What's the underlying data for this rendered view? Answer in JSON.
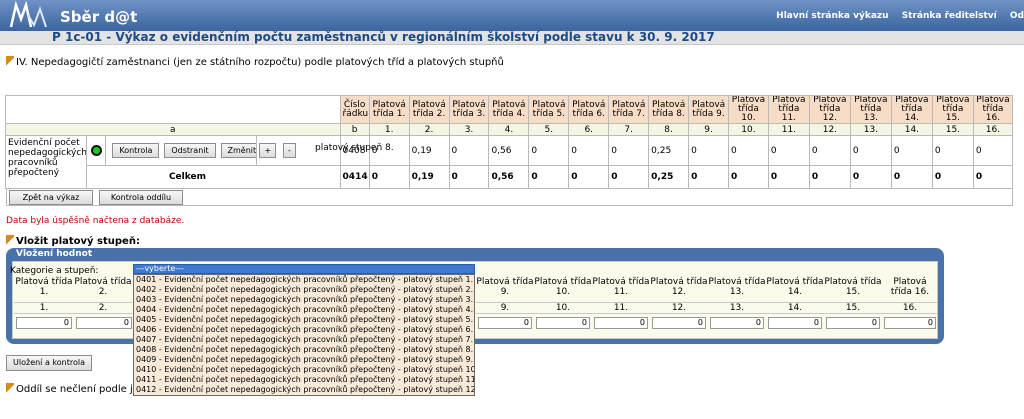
{
  "header": {
    "app_title": "Sběr d@t",
    "links": [
      "Hlavní stránka výkazu",
      "Stránka ředitelství",
      "Od"
    ],
    "report_title": "P 1c-01 - Výkaz o evidenčním počtu zaměstnanců v regionálním školství podle stavu k 30. 9. 2017"
  },
  "section_title": "IV. Nepedagogičtí zaměstnanci (jen ze státního rozpočtu) podle platových tříd a platových stupňů",
  "table": {
    "col_a": "a",
    "col_b_header": "Číslo řádku",
    "col_b": "b",
    "tridy": [
      "Platová třída 1.",
      "Platová třída 2.",
      "Platová třída 3.",
      "Platová třída 4.",
      "Platová třída 5.",
      "Platová třída 6.",
      "Platová třída 7.",
      "Platová třída 8.",
      "Platová třída 9.",
      "Platová třída 10.",
      "Platová třída 11.",
      "Platová třída 12.",
      "Platová třída 13.",
      "Platová třída 14.",
      "Platová třída 15.",
      "Platová třída 16."
    ],
    "nums": [
      "1.",
      "2.",
      "3.",
      "4.",
      "5.",
      "6.",
      "7.",
      "8.",
      "9.",
      "10.",
      "11.",
      "12.",
      "13.",
      "14.",
      "15.",
      "16."
    ],
    "row_label": "Evidenční počet nepedagogických pracovníků přepočtený",
    "buttons": {
      "kontrola": "Kontrola",
      "odstranit": "Odstranit",
      "zmenit": "Změnit",
      "plus": "+",
      "minus": "-"
    },
    "row1": {
      "label": "platový stupeň 8.",
      "code": "0408",
      "values": [
        "0",
        "0,19",
        "0",
        "0,56",
        "0",
        "0",
        "0",
        "0,25",
        "0",
        "0",
        "0",
        "0",
        "0",
        "0",
        "0",
        "0"
      ]
    },
    "row2": {
      "label": "Celkem",
      "code": "0414",
      "values": [
        "0",
        "0,19",
        "0",
        "0,56",
        "0",
        "0",
        "0",
        "0,25",
        "0",
        "0",
        "0",
        "0",
        "0",
        "0",
        "0",
        "0"
      ]
    }
  },
  "actions": {
    "back": "Zpět na výkaz",
    "check_section": "Kontrola oddílu"
  },
  "success_msg": "Data byla úspěšně načtena z databáze.",
  "insert_title": "Vložit platový stupeň:",
  "panel": {
    "title": "Vložení hodnot",
    "category_label": "Kategorie a stupeň:",
    "select_value": "---vyberte---",
    "options": [
      "0401 - Evidenční počet nepedagogických pracovníků přepočtený - platový stupeň 1.",
      "0402 - Evidenční počet nepedagogických pracovníků přepočtený - platový stupeň 2.",
      "0403 - Evidenční počet nepedagogických pracovníků přepočtený - platový stupeň 3.",
      "0404 - Evidenční počet nepedagogických pracovníků přepočtený - platový stupeň 4.",
      "0405 - Evidenční počet nepedagogických pracovníků přepočtený - platový stupeň 5.",
      "0406 - Evidenční počet nepedagogických pracovníků přepočtený - platový stupeň 6.",
      "0407 - Evidenční počet nepedagogických pracovníků přepočtený - platový stupeň 7.",
      "0408 - Evidenční počet nepedagogických pracovníků přepočtený - platový stupeň 8.",
      "0409 - Evidenční počet nepedagogických pracovníků přepočtený - platový stupeň 9.",
      "0410 - Evidenční počet nepedagogických pracovníků přepočtený - platový stupeň 10.",
      "0411 - Evidenční počet nepedagogických pracovníků přepočtený - platový stupeň 11.",
      "0412 - Evidenční počet nepedagogických pracovníků přepočtený - platový stupeň 12."
    ],
    "left_cols": [
      {
        "label": "Platová třída 1.",
        "num": "1.",
        "value": "0"
      },
      {
        "label": "Platová třída 2.",
        "num": "2.",
        "value": "0"
      }
    ],
    "right_cols": [
      {
        "label": "Platová třída 9.",
        "num": "9.",
        "value": "0"
      },
      {
        "label": "Platová třída 10.",
        "num": "10.",
        "value": "0"
      },
      {
        "label": "Platová třída 11.",
        "num": "11.",
        "value": "0"
      },
      {
        "label": "Platová třída 12.",
        "num": "12.",
        "value": "0"
      },
      {
        "label": "Platová třída 13.",
        "num": "13.",
        "value": "0"
      },
      {
        "label": "Platová třída 14.",
        "num": "14.",
        "value": "0"
      },
      {
        "label": "Platová třída 15.",
        "num": "15.",
        "value": "0"
      },
      {
        "label": "Platová třída 16.",
        "num": "16.",
        "value": "0"
      }
    ]
  },
  "save_button": "Uložení a kontrola",
  "footer_note": "Oddíl se nečlení podle jednoti"
}
